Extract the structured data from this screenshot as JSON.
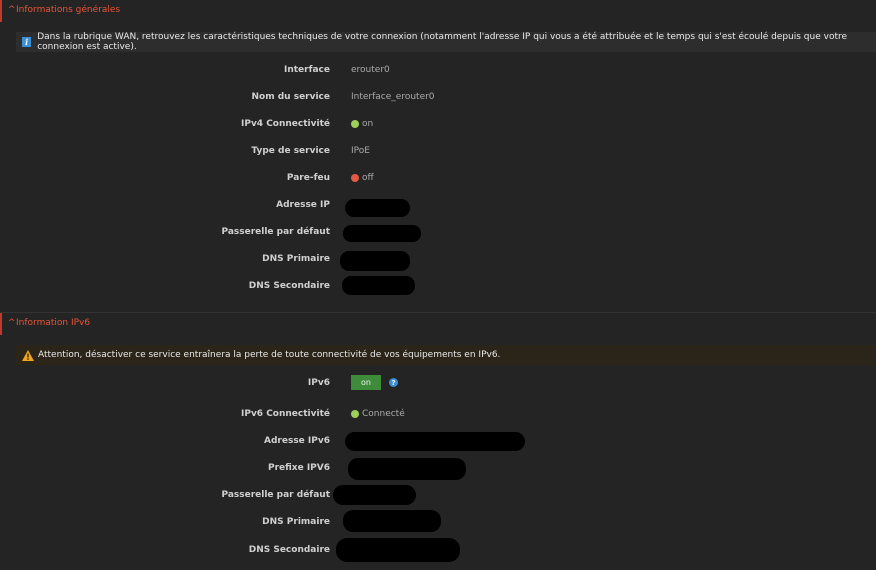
{
  "general": {
    "title": "Informations générales",
    "info_text": "Dans la rubrique WAN, retrouvez les caractéristiques techniques de votre connexion (notamment l'adresse IP qui vous a été attribuée et le temps qui s'est écoulé depuis que votre connexion est active).",
    "rows": [
      {
        "label": "Interface",
        "value": "erouter0"
      },
      {
        "label": "Nom du service",
        "value": "Interface_erouter0"
      },
      {
        "label": "IPv4 Connectivité",
        "value": "on",
        "status": "green"
      },
      {
        "label": "Type de service",
        "value": "IPoE"
      },
      {
        "label": "Pare-feu",
        "value": "off",
        "status": "red"
      },
      {
        "label": "Adresse IP",
        "value": ""
      },
      {
        "label": "Passerelle par défaut",
        "value": ""
      },
      {
        "label": "DNS Primaire",
        "value": ""
      },
      {
        "label": "DNS Secondaire",
        "value": ""
      }
    ]
  },
  "ipv6": {
    "title": "Information IPv6",
    "warning_text": "Attention, désactiver ce service entraînera la perte de toute connectivité de vos équipements en IPv6.",
    "toggle_label": "IPv6",
    "toggle_value": "on",
    "help_glyph": "?",
    "rows": [
      {
        "label": "IPv6 Connectivité",
        "value": "Connecté",
        "status": "green"
      },
      {
        "label": "Adresse IPv6",
        "value": ""
      },
      {
        "label": "Prefixe IPV6",
        "value": ""
      },
      {
        "label": "Passerelle par défaut",
        "value": ""
      },
      {
        "label": "DNS Primaire",
        "value": ""
      },
      {
        "label": "DNS Secondaire",
        "value": ""
      }
    ]
  },
  "colors": {
    "accent": "#e8553a",
    "status_green": "#9ccf5b",
    "status_red": "#e25a46",
    "toggle_on": "#3e8c3a",
    "info_blue": "#3b8fd6"
  },
  "icons": {
    "chevron": "chevron-up-icon",
    "info": "info-icon",
    "warning": "warning-icon",
    "help": "help-icon"
  }
}
